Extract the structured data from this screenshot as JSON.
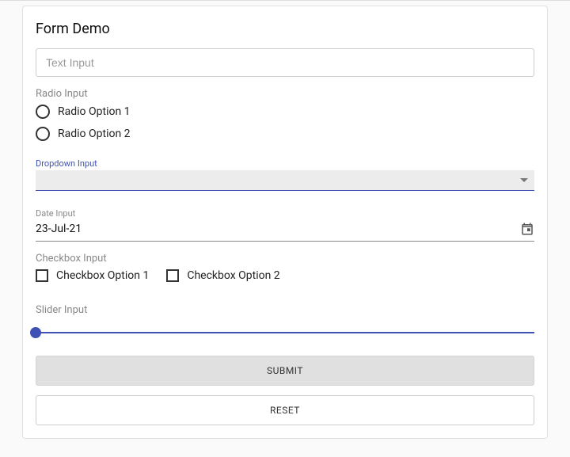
{
  "title": "Form Demo",
  "text_input": {
    "placeholder": "Text Input",
    "value": ""
  },
  "radio": {
    "group_label": "Radio Input",
    "options": [
      {
        "label": "Radio Option 1"
      },
      {
        "label": "Radio Option 2"
      }
    ]
  },
  "dropdown": {
    "label": "Dropdown Input",
    "value": ""
  },
  "date": {
    "label": "Date Input",
    "value": "23-Jul-21"
  },
  "checkbox": {
    "group_label": "Checkbox Input",
    "options": [
      {
        "label": "Checkbox Option 1"
      },
      {
        "label": "Checkbox Option 2"
      }
    ]
  },
  "slider": {
    "label": "Slider Input"
  },
  "buttons": {
    "submit": "SUBMIT",
    "reset": "RESET"
  }
}
